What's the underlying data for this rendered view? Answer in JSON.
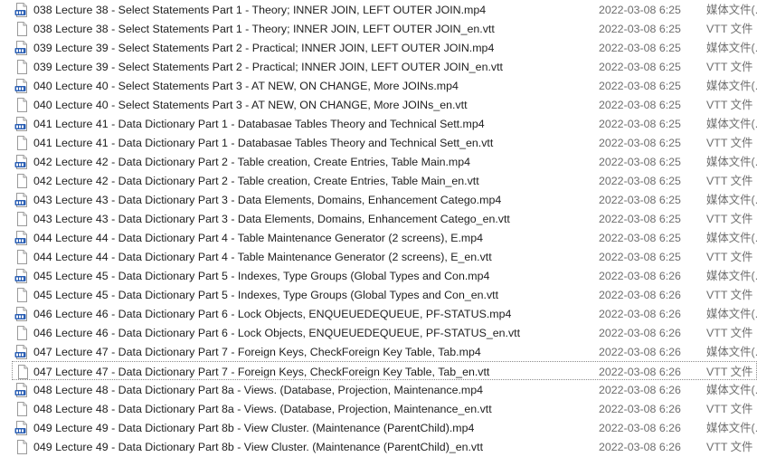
{
  "files": [
    {
      "name": "038 Lecture 38 - Select Statements Part 1 - Theory; INNER JOIN, LEFT OUTER JOIN.mp4",
      "date": "2022-03-08 6:25",
      "type": "媒体文件(.",
      "icon": "mp4-file-icon"
    },
    {
      "name": "038 Lecture 38 - Select Statements Part 1 - Theory; INNER JOIN, LEFT OUTER JOIN_en.vtt",
      "date": "2022-03-08 6:25",
      "type": "VTT 文件",
      "icon": "vtt-file-icon"
    },
    {
      "name": "039 Lecture 39 - Select Statements Part 2 - Practical; INNER JOIN, LEFT OUTER JOIN.mp4",
      "date": "2022-03-08 6:25",
      "type": "媒体文件(.",
      "icon": "mp4-file-icon"
    },
    {
      "name": "039 Lecture 39 - Select Statements Part 2 - Practical; INNER JOIN, LEFT OUTER JOIN_en.vtt",
      "date": "2022-03-08 6:25",
      "type": "VTT 文件",
      "icon": "vtt-file-icon"
    },
    {
      "name": "040 Lecture 40 - Select Statements Part 3 - AT NEW, ON CHANGE, More JOINs.mp4",
      "date": "2022-03-08 6:25",
      "type": "媒体文件(.",
      "icon": "mp4-file-icon"
    },
    {
      "name": "040 Lecture 40 - Select Statements Part 3 - AT NEW, ON CHANGE, More JOINs_en.vtt",
      "date": "2022-03-08 6:25",
      "type": "VTT 文件",
      "icon": "vtt-file-icon"
    },
    {
      "name": "041 Lecture 41 - Data Dictionary Part 1 - Databasae Tables Theory and Technical Sett.mp4",
      "date": "2022-03-08 6:25",
      "type": "媒体文件(.",
      "icon": "mp4-file-icon"
    },
    {
      "name": "041 Lecture 41 - Data Dictionary Part 1 - Databasae Tables Theory and Technical Sett_en.vtt",
      "date": "2022-03-08 6:25",
      "type": "VTT 文件",
      "icon": "vtt-file-icon"
    },
    {
      "name": "042 Lecture 42 - Data Dictionary Part 2 - Table creation, Create Entries, Table Main.mp4",
      "date": "2022-03-08 6:25",
      "type": "媒体文件(.",
      "icon": "mp4-file-icon"
    },
    {
      "name": "042 Lecture 42 - Data Dictionary Part 2 - Table creation, Create Entries, Table Main_en.vtt",
      "date": "2022-03-08 6:25",
      "type": "VTT 文件",
      "icon": "vtt-file-icon"
    },
    {
      "name": "043 Lecture 43 - Data Dictionary Part 3 - Data Elements, Domains, Enhancement Catego.mp4",
      "date": "2022-03-08 6:25",
      "type": "媒体文件(.",
      "icon": "mp4-file-icon"
    },
    {
      "name": "043 Lecture 43 - Data Dictionary Part 3 - Data Elements, Domains, Enhancement Catego_en.vtt",
      "date": "2022-03-08 6:25",
      "type": "VTT 文件",
      "icon": "vtt-file-icon"
    },
    {
      "name": "044 Lecture 44 - Data Dictionary Part 4 - Table Maintenance Generator (2 screens), E.mp4",
      "date": "2022-03-08 6:25",
      "type": "媒体文件(.",
      "icon": "mp4-file-icon"
    },
    {
      "name": "044 Lecture 44 - Data Dictionary Part 4 - Table Maintenance Generator (2 screens), E_en.vtt",
      "date": "2022-03-08 6:25",
      "type": "VTT 文件",
      "icon": "vtt-file-icon"
    },
    {
      "name": "045 Lecture 45 - Data Dictionary Part 5 - Indexes, Type Groups (Global Types and Con.mp4",
      "date": "2022-03-08 6:26",
      "type": "媒体文件(.",
      "icon": "mp4-file-icon"
    },
    {
      "name": "045 Lecture 45 - Data Dictionary Part 5 - Indexes, Type Groups (Global Types and Con_en.vtt",
      "date": "2022-03-08 6:26",
      "type": "VTT 文件",
      "icon": "vtt-file-icon"
    },
    {
      "name": "046 Lecture 46 - Data Dictionary Part 6 - Lock Objects, ENQUEUEDEQUEUE, PF-STATUS.mp4",
      "date": "2022-03-08 6:26",
      "type": "媒体文件(.",
      "icon": "mp4-file-icon"
    },
    {
      "name": "046 Lecture 46 - Data Dictionary Part 6 - Lock Objects, ENQUEUEDEQUEUE, PF-STATUS_en.vtt",
      "date": "2022-03-08 6:26",
      "type": "VTT 文件",
      "icon": "vtt-file-icon"
    },
    {
      "name": "047 Lecture 47 - Data Dictionary Part 7 - Foreign Keys, CheckForeign Key Table, Tab.mp4",
      "date": "2022-03-08 6:26",
      "type": "媒体文件(.",
      "icon": "mp4-file-icon"
    },
    {
      "name": "047 Lecture 47 - Data Dictionary Part 7 - Foreign Keys, CheckForeign Key Table, Tab_en.vtt",
      "date": "2022-03-08 6:26",
      "type": "VTT 文件",
      "icon": "vtt-file-icon",
      "selected": true
    },
    {
      "name": "048 Lecture 48 - Data Dictionary Part 8a - Views. (Database, Projection, Maintenance.mp4",
      "date": "2022-03-08 6:26",
      "type": "媒体文件(.",
      "icon": "mp4-file-icon"
    },
    {
      "name": "048 Lecture 48 - Data Dictionary Part 8a - Views. (Database, Projection, Maintenance_en.vtt",
      "date": "2022-03-08 6:26",
      "type": "VTT 文件",
      "icon": "vtt-file-icon"
    },
    {
      "name": "049 Lecture 49 - Data Dictionary Part 8b - View Cluster. (Maintenance (ParentChild).mp4",
      "date": "2022-03-08 6:26",
      "type": "媒体文件(.",
      "icon": "mp4-file-icon"
    },
    {
      "name": "049 Lecture 49 - Data Dictionary Part 8b - View Cluster. (Maintenance (ParentChild)_en.vtt",
      "date": "2022-03-08 6:26",
      "type": "VTT 文件",
      "icon": "vtt-file-icon"
    }
  ],
  "colors": {
    "mp4_badge": "#2b5fb4",
    "file_border": "#9a9a9a",
    "secondary_text": "#6d6d6d"
  }
}
